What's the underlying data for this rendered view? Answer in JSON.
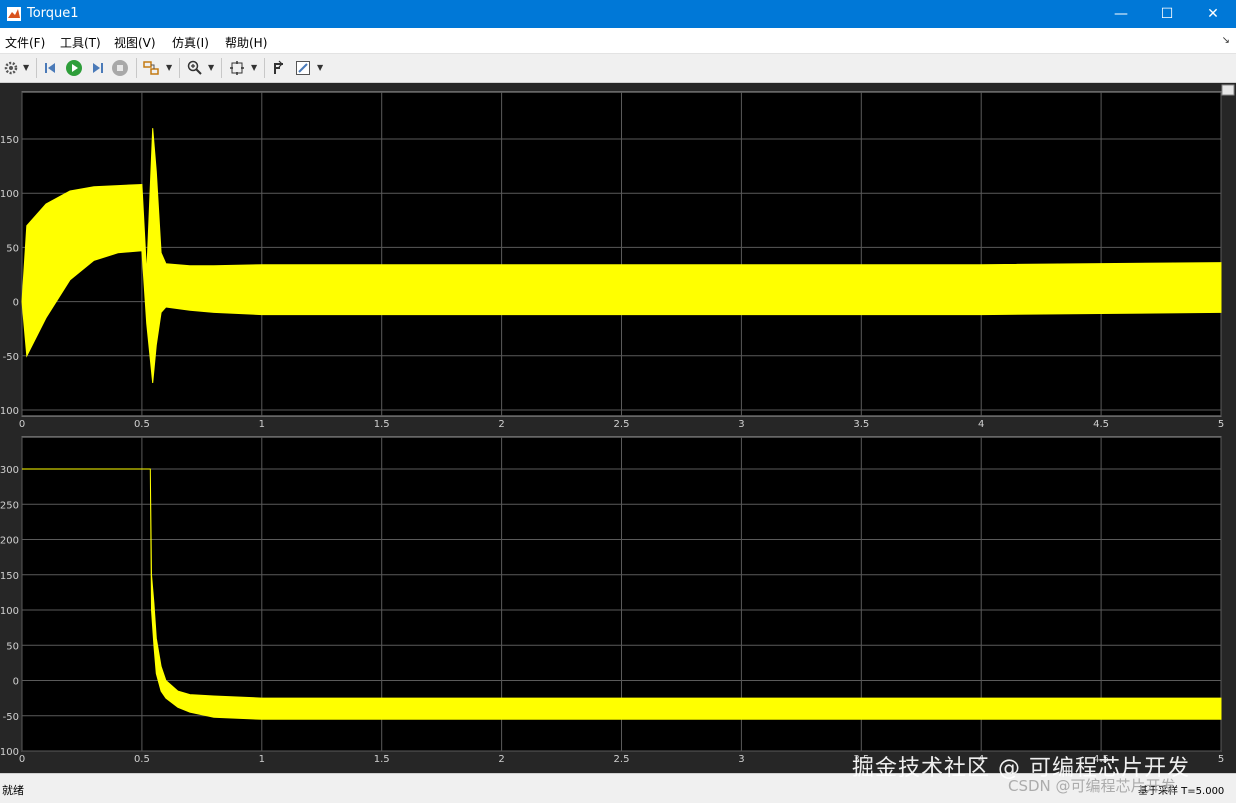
{
  "window": {
    "title": "Torque1",
    "minimize": "—",
    "maximize": "☐",
    "close": "✕"
  },
  "menu": [
    {
      "label": "文件(F)"
    },
    {
      "label": "工具(T)"
    },
    {
      "label": "视图(V)"
    },
    {
      "label": "仿真(I)"
    },
    {
      "label": "帮助(H)"
    }
  ],
  "toolbar": {
    "icons": [
      "gear-icon",
      "step-back-icon",
      "run-icon",
      "step-forward-icon",
      "stop-icon",
      "highlight-icon",
      "zoom-icon",
      "fit-icon",
      "cursor-icon",
      "style-icon"
    ]
  },
  "status": {
    "left": "就绪",
    "right": "基于采样 T=5.000"
  },
  "watermark": {
    "line1": "掘金技术社区 @ 可编程芯片开发",
    "line2": "CSDN @可编程芯片开发"
  },
  "chart_data": [
    {
      "type": "line",
      "title": "",
      "xlabel": "",
      "ylabel": "",
      "xlim": [
        0,
        5
      ],
      "ylim": [
        -100,
        185
      ],
      "x_ticks": [
        "0",
        "0.5",
        "1",
        "1.5",
        "2",
        "2.5",
        "3",
        "3.5",
        "4",
        "4.5",
        "5"
      ],
      "y_ticks": [
        "-100",
        "-50",
        "0",
        "50",
        "100",
        "150"
      ],
      "y_tick_values": [
        -100,
        -50,
        0,
        50,
        100,
        150
      ],
      "grid": true,
      "line_color": "#ffff00",
      "series": [
        {
          "band_x": [
            0,
            0.02,
            0.1,
            0.2,
            0.3,
            0.4,
            0.5,
            0.52,
            0.545,
            0.56,
            0.58,
            0.6,
            0.7,
            0.8,
            1.0,
            2.0,
            3.0,
            4.0,
            5.0
          ],
          "band_upper": [
            0,
            70,
            90,
            102,
            106,
            107,
            108,
            25,
            160,
            120,
            45,
            35,
            33,
            33,
            34,
            34,
            34,
            34,
            36
          ],
          "band_lower": [
            0,
            -50,
            -15,
            20,
            38,
            45,
            47,
            -20,
            -75,
            -40,
            -10,
            -5,
            -8,
            -10,
            -12,
            -12,
            -12,
            -12,
            -10
          ]
        }
      ]
    },
    {
      "type": "line",
      "title": "",
      "xlabel": "",
      "ylabel": "",
      "xlim": [
        0,
        5
      ],
      "ylim": [
        -100,
        320
      ],
      "x_ticks": [
        "0",
        "0.5",
        "1",
        "1.5",
        "2",
        "2.5",
        "3",
        "3.5",
        "4",
        "4.5",
        "5"
      ],
      "y_ticks": [
        "-100",
        "-50",
        "0",
        "50",
        "100",
        "150",
        "200",
        "250",
        "300"
      ],
      "y_tick_values": [
        -100,
        -50,
        0,
        50,
        100,
        150,
        200,
        250,
        300
      ],
      "grid": true,
      "line_color": "#ffff00",
      "series": [
        {
          "band_x": [
            0,
            0.535,
            0.54,
            0.55,
            0.56,
            0.58,
            0.6,
            0.65,
            0.7,
            0.8,
            1.0,
            2.0,
            3.0,
            4.0,
            5.0
          ],
          "band_upper": [
            300,
            300,
            150,
            110,
            60,
            20,
            0,
            -15,
            -20,
            -22,
            -25,
            -25,
            -25,
            -25,
            -25
          ],
          "band_lower": [
            300,
            300,
            100,
            50,
            10,
            -15,
            -25,
            -38,
            -45,
            -52,
            -55,
            -55,
            -55,
            -55,
            -55
          ]
        }
      ]
    }
  ]
}
